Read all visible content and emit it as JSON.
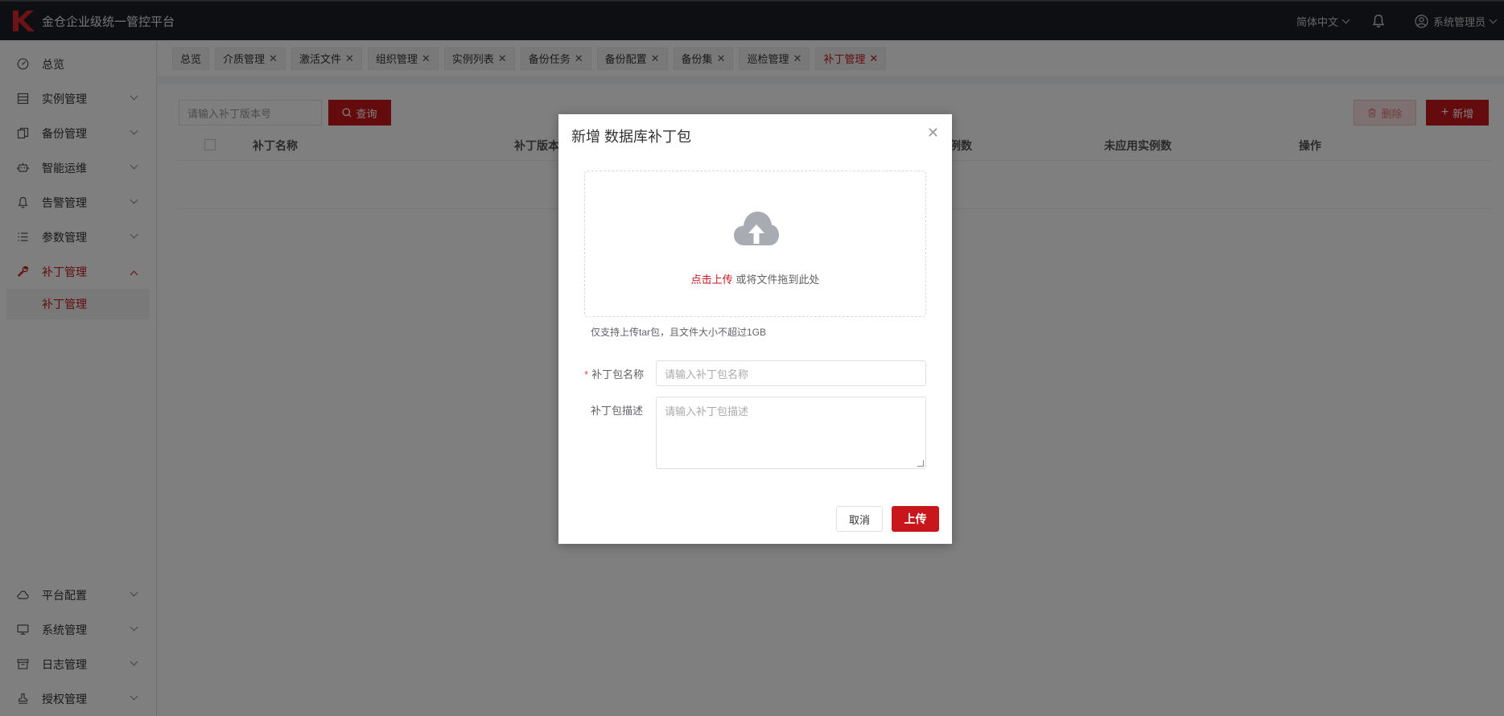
{
  "header": {
    "app_title": "金仓企业级统一管控平台",
    "language": "简体中文",
    "user": "系统管理员"
  },
  "sidebar": {
    "items": [
      {
        "label": "总览",
        "icon": "dashboard-icon"
      },
      {
        "label": "实例管理",
        "icon": "list-icon"
      },
      {
        "label": "备份管理",
        "icon": "copy-icon"
      },
      {
        "label": "智能运维",
        "icon": "robot-icon"
      },
      {
        "label": "告警管理",
        "icon": "bell-icon"
      },
      {
        "label": "参数管理",
        "icon": "params-icon"
      },
      {
        "label": "补丁管理",
        "icon": "wrench-icon",
        "active": true
      }
    ],
    "sub_item": "补丁管理",
    "bottom_items": [
      {
        "label": "平台配置",
        "icon": "cloud-icon"
      },
      {
        "label": "系统管理",
        "icon": "monitor-icon"
      },
      {
        "label": "日志管理",
        "icon": "archive-icon"
      },
      {
        "label": "授权管理",
        "icon": "stamp-icon"
      }
    ]
  },
  "tabs": [
    {
      "label": "总览",
      "closable": false
    },
    {
      "label": "介质管理",
      "closable": true
    },
    {
      "label": "激活文件",
      "closable": true
    },
    {
      "label": "组织管理",
      "closable": true
    },
    {
      "label": "实例列表",
      "closable": true
    },
    {
      "label": "备份任务",
      "closable": true
    },
    {
      "label": "备份配置",
      "closable": true
    },
    {
      "label": "备份集",
      "closable": true
    },
    {
      "label": "巡检管理",
      "closable": true
    },
    {
      "label": "补丁管理",
      "closable": true,
      "active": true
    }
  ],
  "toolbar": {
    "search_placeholder": "请输入补丁版本号",
    "query_label": "查询",
    "delete_label": "删除",
    "add_label": "新增"
  },
  "table": {
    "columns": [
      "补丁名称",
      "补丁版本",
      "例数",
      "未应用实例数",
      "操作"
    ]
  },
  "dialog": {
    "title": "新增 数据库补丁包",
    "upload_link": "点击上传",
    "upload_text": "或将文件拖到此处",
    "tip": "仅支持上传tar包，且文件大小不超过1GB",
    "name_label": "补丁包名称",
    "name_placeholder": "请输入补丁包名称",
    "desc_label": "补丁包描述",
    "desc_placeholder": "请输入补丁包描述",
    "cancel_label": "取消",
    "upload_label": "上传"
  },
  "colors": {
    "brand": "#c8161d",
    "header_bg": "#1c1f24"
  }
}
